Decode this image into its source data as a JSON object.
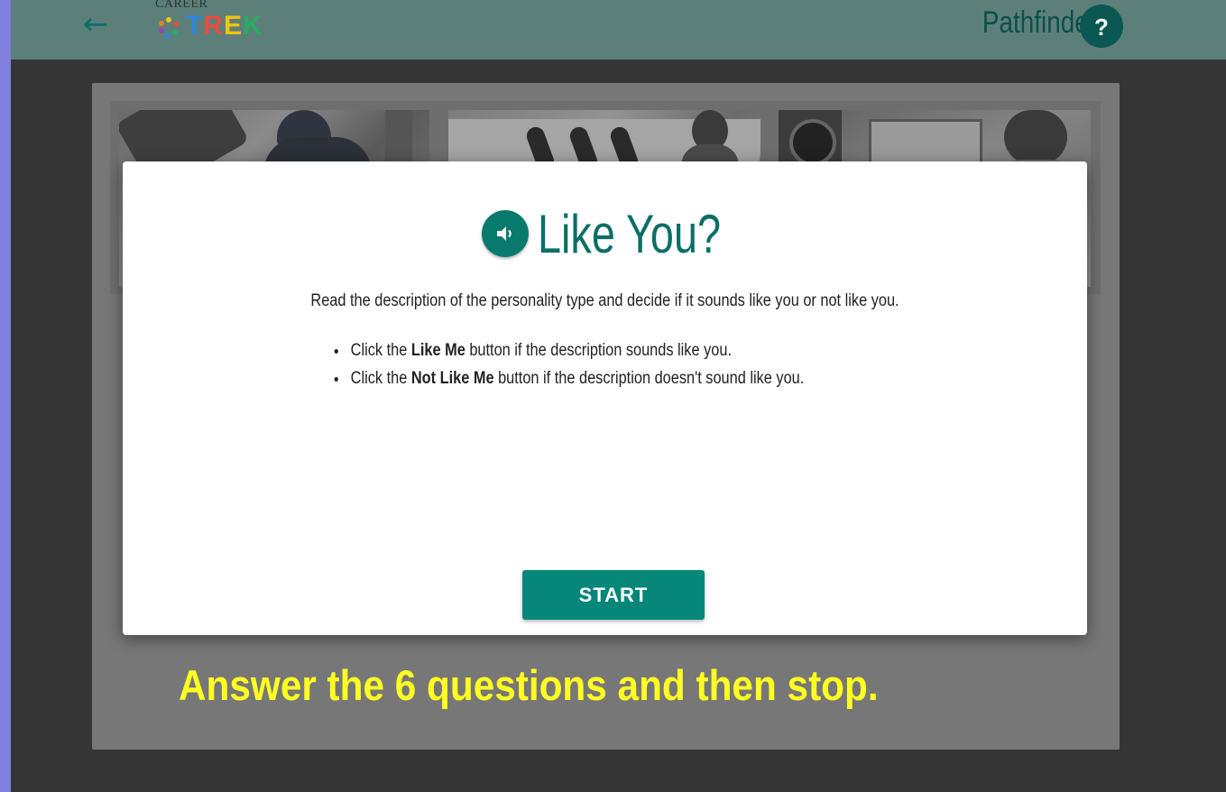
{
  "header": {
    "back_icon": "arrow-left-icon",
    "logo_small": "CAREER",
    "logo_word": "TREK",
    "logo_colors": [
      "#2e86de",
      "#e74c3c",
      "#f1c40f",
      "#27ae60"
    ],
    "app_name": "Pathfinder",
    "help_label": "?"
  },
  "modal": {
    "title": "Like You?",
    "audio_icon": "speaker-icon",
    "intro": "Read the description of the personality type and decide if it sounds like you or not like you.",
    "bullets": [
      {
        "pre": "Click the ",
        "bold": "Like Me",
        "post": " button if the description sounds like you."
      },
      {
        "pre": "Click the ",
        "bold": "Not Like Me",
        "post": " button if the description doesn't sound like you."
      }
    ],
    "start_label": "START"
  },
  "banner": "Answer the 6 questions and then stop.",
  "colors": {
    "teal_bar": "#5d7f7a",
    "accent": "#07867a",
    "banner_text": "#ffff22"
  }
}
